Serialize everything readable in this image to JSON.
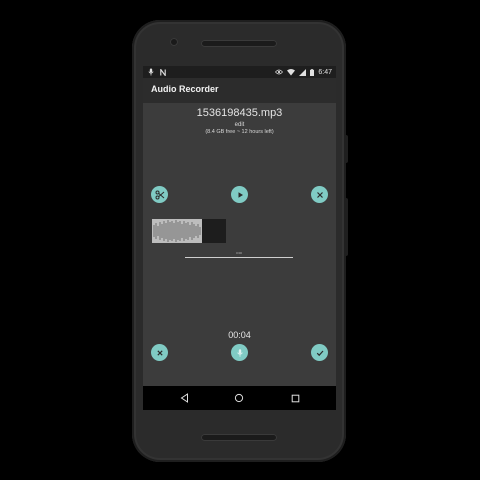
{
  "statusbar": {
    "time": "6:47"
  },
  "app": {
    "title": "Audio Recorder"
  },
  "recording": {
    "filename": "1536198435.mp3",
    "edit_label": "edit",
    "storage_info": "(8.4 GB free ~ 12 hours left)",
    "timeline_label": "0:00",
    "elapsed": "00:04",
    "progress_fraction": 0.68
  },
  "icons": {
    "cut": "scissors-icon",
    "play": "play-icon",
    "close": "close-icon",
    "cancel": "cancel-icon",
    "mic": "microphone-icon",
    "done": "check-icon",
    "back": "back-triangle-icon",
    "home": "home-circle-icon",
    "recents": "recents-square-icon"
  },
  "colors": {
    "accent": "#80cbc4",
    "appbar": "#2c2c2c",
    "screen": "#3c3c3c"
  }
}
